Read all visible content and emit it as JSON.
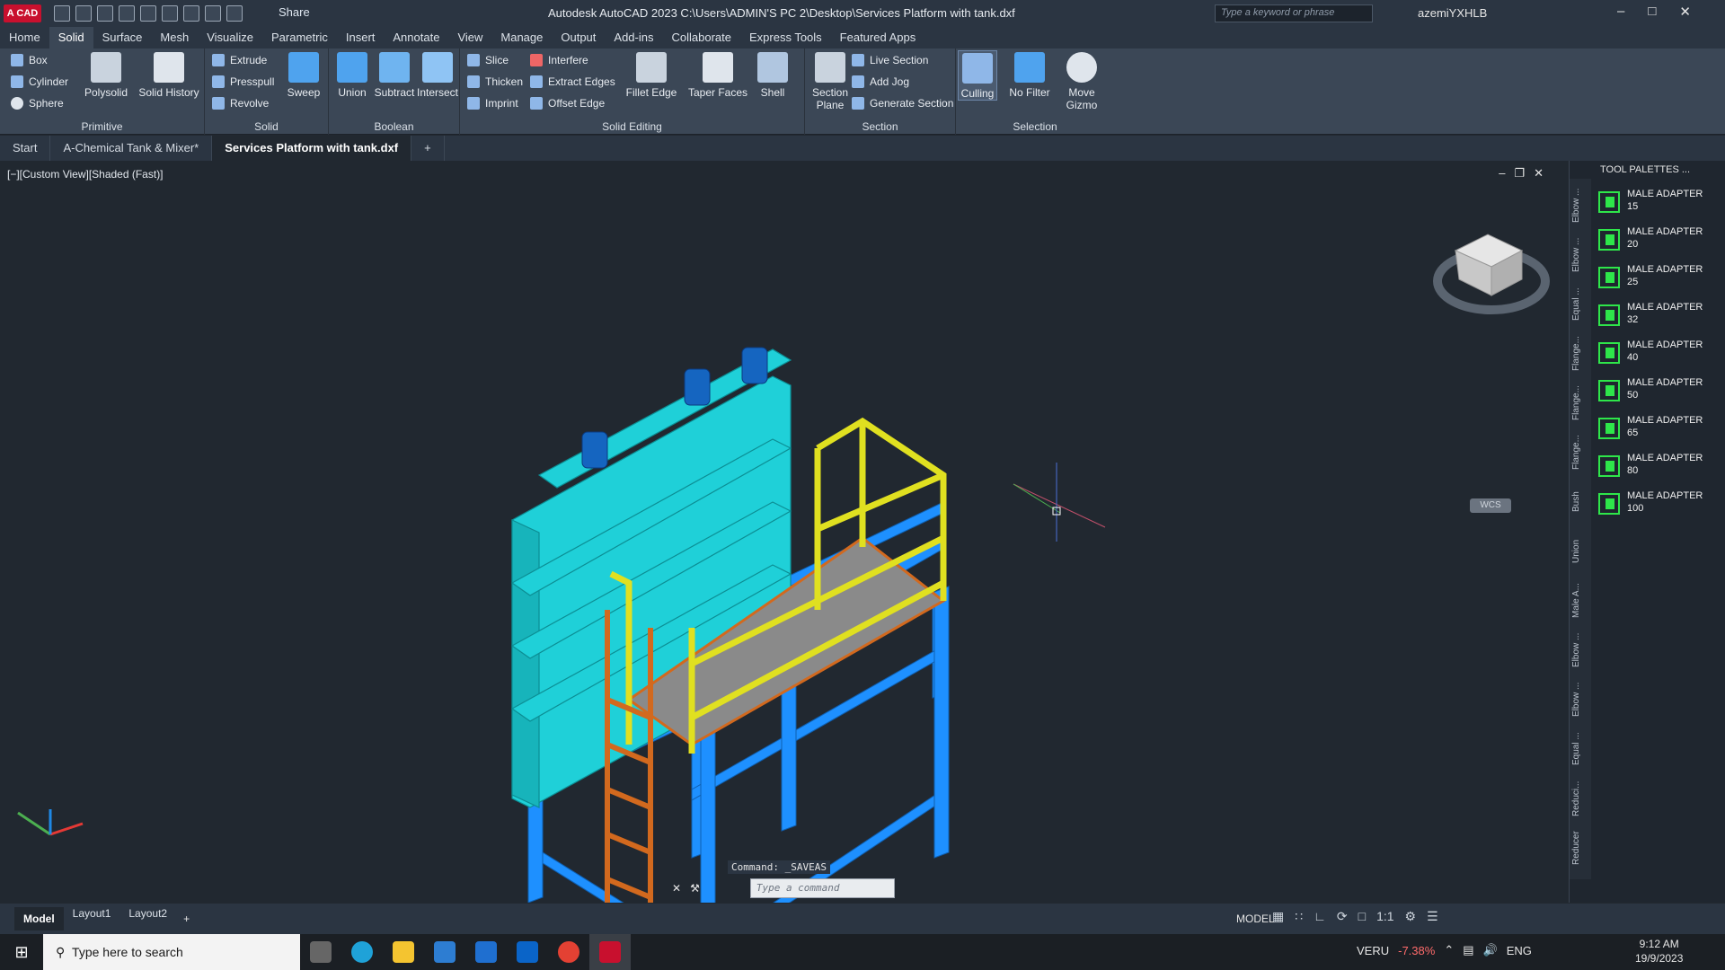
{
  "app": {
    "logo": "A CAD",
    "title": "Autodesk AutoCAD 2023   C:\\Users\\ADMIN'S PC 2\\Desktop\\Services Platform with tank.dxf",
    "search_placeholder": "Type a keyword or phrase",
    "user": "azemiYXHLB",
    "share": "Share"
  },
  "ribbon_tabs": [
    "Home",
    "Solid",
    "Surface",
    "Mesh",
    "Visualize",
    "Parametric",
    "Insert",
    "Annotate",
    "View",
    "Manage",
    "Output",
    "Add-ins",
    "Collaborate",
    "Express Tools",
    "Featured Apps"
  ],
  "active_ribbon_tab": "Solid",
  "panels": {
    "primitive": {
      "label": "Primitive",
      "box": "Box",
      "cylinder": "Cylinder",
      "sphere": "Sphere",
      "polysolid": "Polysolid",
      "history": "Solid History"
    },
    "solid": {
      "label": "Solid",
      "extrude": "Extrude",
      "presspull": "Presspull",
      "revolve": "Revolve",
      "sweep": "Sweep"
    },
    "boolean": {
      "label": "Boolean",
      "union": "Union",
      "subtract": "Subtract",
      "intersect": "Intersect"
    },
    "editing": {
      "label": "Solid Editing",
      "slice": "Slice",
      "thicken": "Thicken",
      "imprint": "Imprint",
      "interfere": "Interfere",
      "extract": "Extract Edges",
      "offset": "Offset Edge",
      "fillet": "Fillet Edge",
      "taper": "Taper Faces",
      "shell": "Shell"
    },
    "section": {
      "label": "Section",
      "plane": "Section Plane",
      "live": "Live Section",
      "jog": "Add Jog",
      "generate": "Generate Section"
    },
    "selection": {
      "label": "Selection",
      "culling": "Culling",
      "filter": "No Filter",
      "gizmo": "Move Gizmo"
    }
  },
  "doc_tabs": [
    "Start",
    "A-Chemical Tank & Mixer*",
    "Services Platform with tank.dxf"
  ],
  "viewport": {
    "label": "[−][Custom View][Shaded (Fast)]",
    "wcs": "WCS"
  },
  "palettes": {
    "title": "TOOL PALETTES ...",
    "side_tabs": [
      "Elbow ...",
      "Elbow ...",
      "Equal ...",
      "Flange...",
      "Flange...",
      "Flange...",
      "Bush",
      "Union",
      "Male A...",
      "Elbow ...",
      "Elbow ...",
      "Equal ...",
      "Reduci...",
      "Reducer"
    ],
    "items": [
      {
        "name": "MALE ADAPTER",
        "size": "15"
      },
      {
        "name": "MALE ADAPTER",
        "size": "20"
      },
      {
        "name": "MALE ADAPTER",
        "size": "25"
      },
      {
        "name": "MALE ADAPTER",
        "size": "32"
      },
      {
        "name": "MALE ADAPTER",
        "size": "40"
      },
      {
        "name": "MALE ADAPTER",
        "size": "50"
      },
      {
        "name": "MALE ADAPTER",
        "size": "65"
      },
      {
        "name": "MALE ADAPTER",
        "size": "80"
      },
      {
        "name": "MALE ADAPTER",
        "size": "100"
      }
    ]
  },
  "command": {
    "history": "Command:  _SAVEAS",
    "placeholder": "Type a command"
  },
  "layout_tabs": [
    "Model",
    "Layout1",
    "Layout2"
  ],
  "status": {
    "model": "MODEL",
    "scale": "1:1"
  },
  "taskbar": {
    "search": "Type here to search",
    "stock": "VERU",
    "stock_change": "-7.38%",
    "lang": "ENG",
    "time": "9:12 AM",
    "date": "19/9/2023"
  },
  "colors": {
    "tank": "#1fd0d8",
    "frame": "#1e90ff",
    "rail": "#e0e020",
    "ladder": "#d2691e",
    "deck": "#8a8a8a"
  }
}
